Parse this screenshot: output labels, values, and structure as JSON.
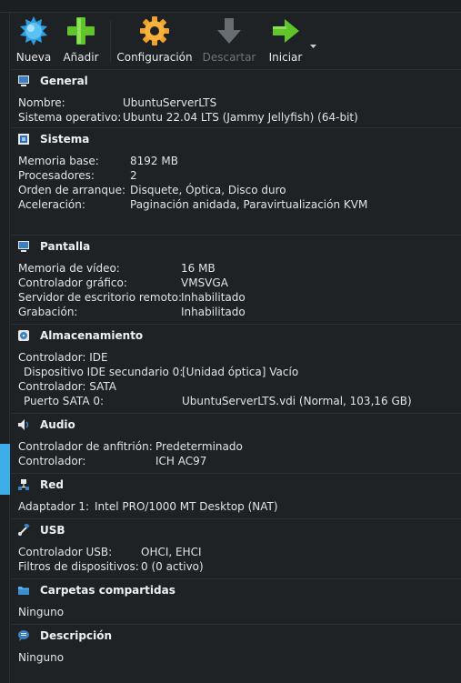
{
  "toolbar": {
    "nueva": "Nueva",
    "anadir": "Añadir",
    "configuracion": "Configuración",
    "descartar": "Descartar",
    "iniciar": "Iniciar"
  },
  "general": {
    "title": "General",
    "rows": [
      {
        "k": "Nombre:",
        "v": "UbuntuServerLTS"
      },
      {
        "k": "Sistema operativo:",
        "v": "Ubuntu 22.04 LTS (Jammy Jellyfish) (64-bit)"
      }
    ]
  },
  "sistema": {
    "title": "Sistema",
    "rows": [
      {
        "k": "Memoria base:",
        "v": "8192 MB"
      },
      {
        "k": "Procesadores:",
        "v": "2"
      },
      {
        "k": "Orden de arranque:",
        "v": "Disquete, Óptica, Disco duro"
      },
      {
        "k": "Aceleración:",
        "v": "Paginación anidada, Paravirtualización KVM"
      }
    ]
  },
  "pantalla": {
    "title": "Pantalla",
    "rows": [
      {
        "k": "Memoria de vídeo:",
        "v": "16 MB"
      },
      {
        "k": "Controlador gráfico:",
        "v": "VMSVGA"
      },
      {
        "k": "Servidor de escritorio remoto:",
        "v": "Inhabilitado"
      },
      {
        "k": "Grabación:",
        "v": "Inhabilitado"
      }
    ]
  },
  "almacenamiento": {
    "title": "Almacenamiento",
    "rows": [
      {
        "k": "Controlador: IDE",
        "v": ""
      },
      {
        "k": "Dispositivo IDE secundario 0:",
        "v": "[Unidad óptica] Vacío"
      },
      {
        "k": "Controlador: SATA",
        "v": ""
      },
      {
        "k": "Puerto SATA 0:",
        "v": "UbuntuServerLTS.vdi (Normal, 103,16 GB)"
      }
    ]
  },
  "audio": {
    "title": "Audio",
    "rows": [
      {
        "k": "Controlador de anfitrión:",
        "v": "Predeterminado"
      },
      {
        "k": "Controlador:",
        "v": "ICH AC97"
      }
    ]
  },
  "red": {
    "title": "Red",
    "rows": [
      {
        "k": "Adaptador 1:",
        "v": "Intel PRO/1000 MT Desktop (NAT)"
      }
    ]
  },
  "usb": {
    "title": "USB",
    "rows": [
      {
        "k": "Controlador USB:",
        "v": "OHCI, EHCI"
      },
      {
        "k": "Filtros de dispositivos:",
        "v": "0 (0 activo)"
      }
    ]
  },
  "carpetas": {
    "title": "Carpetas compartidas",
    "value": "Ninguno"
  },
  "descripcion": {
    "title": "Descripción",
    "value": "Ninguno"
  }
}
